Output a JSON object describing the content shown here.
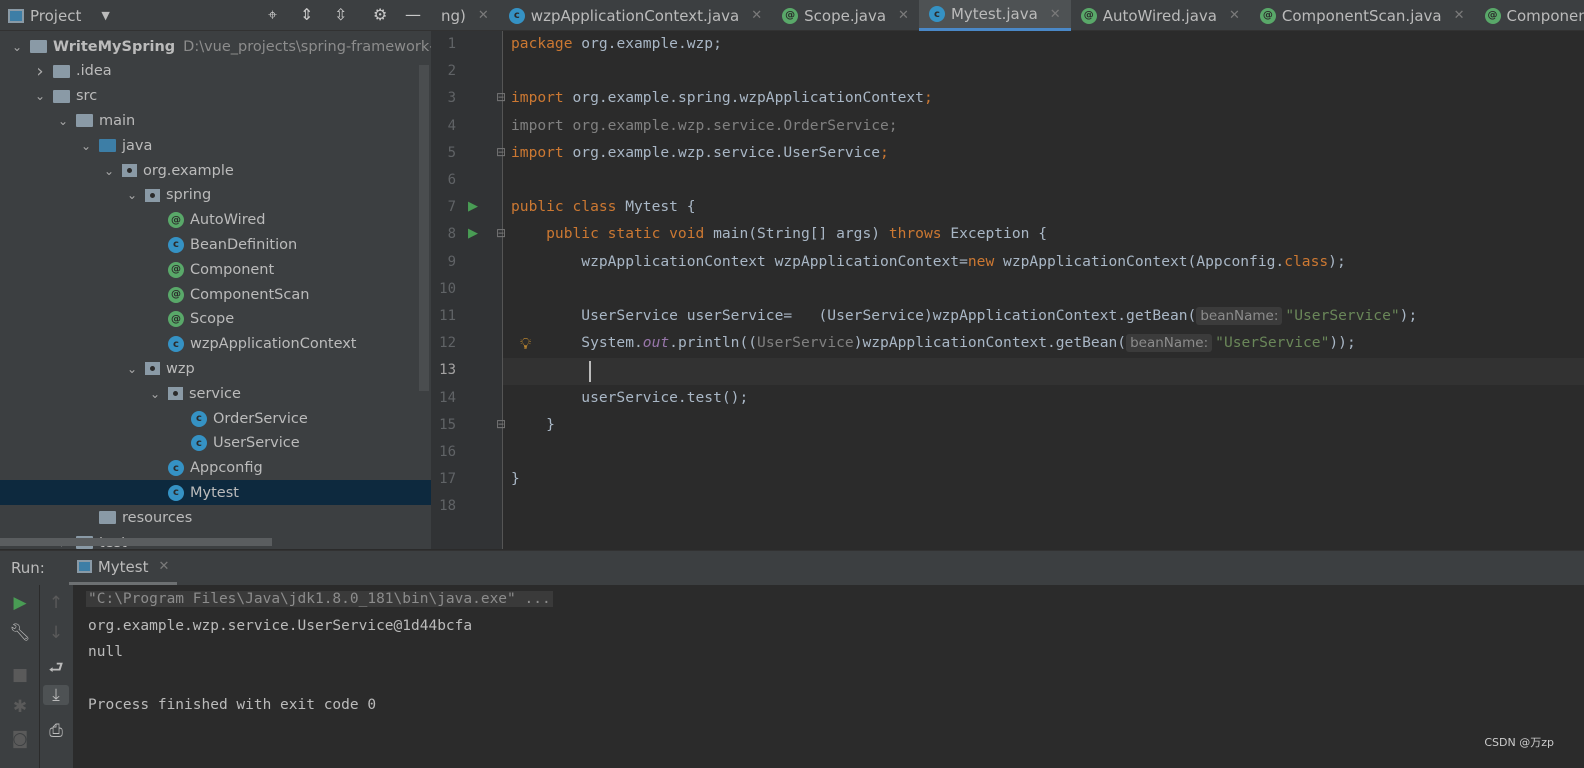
{
  "project_panel": {
    "title": "Project",
    "toolbar_icons": [
      "locate-icon",
      "expand-all-icon",
      "collapse-all-icon",
      "gear-icon",
      "minimize-icon"
    ]
  },
  "tabs": [
    {
      "label": "ng)",
      "icon": "none",
      "active": false
    },
    {
      "label": "wzpApplicationContext.java",
      "icon": "class",
      "active": false
    },
    {
      "label": "Scope.java",
      "icon": "annotation",
      "active": false
    },
    {
      "label": "Mytest.java",
      "icon": "class-run",
      "active": true
    },
    {
      "label": "AutoWired.java",
      "icon": "annotation",
      "active": false
    },
    {
      "label": "ComponentScan.java",
      "icon": "annotation",
      "active": false
    },
    {
      "label": "Component.jav",
      "icon": "annotation",
      "active": false
    }
  ],
  "tree": [
    {
      "label": "WriteMySpring",
      "path": "D:\\vue_projects\\spring-framework-",
      "level": 0,
      "arrow": "down",
      "icon": "module",
      "bold": true
    },
    {
      "label": ".idea",
      "level": 1,
      "arrow": "right",
      "icon": "folder"
    },
    {
      "label": "src",
      "level": 1,
      "arrow": "down",
      "icon": "folder"
    },
    {
      "label": "main",
      "level": 2,
      "arrow": "down",
      "icon": "folder"
    },
    {
      "label": "java",
      "level": 3,
      "arrow": "down",
      "icon": "src-folder"
    },
    {
      "label": "org.example",
      "level": 4,
      "arrow": "down",
      "icon": "package"
    },
    {
      "label": "spring",
      "level": 5,
      "arrow": "down",
      "icon": "package"
    },
    {
      "label": "AutoWired",
      "level": 6,
      "icon": "annotation"
    },
    {
      "label": "BeanDefinition",
      "level": 6,
      "icon": "class"
    },
    {
      "label": "Component",
      "level": 6,
      "icon": "annotation"
    },
    {
      "label": "ComponentScan",
      "level": 6,
      "icon": "annotation"
    },
    {
      "label": "Scope",
      "level": 6,
      "icon": "annotation"
    },
    {
      "label": "wzpApplicationContext",
      "level": 6,
      "icon": "class"
    },
    {
      "label": "wzp",
      "level": 5,
      "arrow": "down",
      "icon": "package"
    },
    {
      "label": "service",
      "level": 6,
      "arrow": "down",
      "icon": "package"
    },
    {
      "label": "OrderService",
      "level": 7,
      "icon": "class"
    },
    {
      "label": "UserService",
      "level": 7,
      "icon": "class"
    },
    {
      "label": "Appconfig",
      "level": 6,
      "icon": "class"
    },
    {
      "label": "Mytest",
      "level": 6,
      "icon": "class",
      "selected": true
    },
    {
      "label": "resources",
      "level": 3,
      "icon": "folder"
    },
    {
      "label": "test",
      "level": 2,
      "arrow": "right",
      "icon": "folder"
    }
  ],
  "editor": {
    "current_line": 13,
    "lines": [
      [
        [
          "kw",
          "package "
        ],
        [
          "",
          "org.example.wzp;"
        ]
      ],
      [],
      [
        [
          "kw",
          "import "
        ],
        [
          "",
          "org.example.spring.wzpApplicationContext"
        ],
        [
          "kw",
          ";"
        ]
      ],
      [
        [
          "gr",
          "import org.example.wzp.service.OrderService;"
        ]
      ],
      [
        [
          "kw",
          "import "
        ],
        [
          "",
          "org.example.wzp.service.UserService"
        ],
        [
          "kw",
          ";"
        ]
      ],
      [],
      [
        [
          "kw",
          "public class "
        ],
        [
          "",
          "Mytest {"
        ]
      ],
      [
        [
          "kw",
          "    public static void "
        ],
        [
          "",
          "main(String[] args) "
        ],
        [
          "kw",
          "throws "
        ],
        [
          "",
          "Exception {"
        ]
      ],
      [
        [
          "",
          "        wzpApplicationContext wzpApplicationContext="
        ],
        [
          "kw",
          "new "
        ],
        [
          "",
          "wzpApplicationContext(Appconfig."
        ],
        [
          "kw",
          "class"
        ],
        [
          "",
          "); "
        ]
      ],
      [],
      [
        [
          "",
          "        UserService userService=   (UserService)wzpApplicationContext.getBean("
        ],
        [
          "hint",
          "beanName:"
        ],
        [
          "str",
          "\"UserService\""
        ],
        [
          "",
          ");"
        ]
      ],
      [
        [
          "",
          "        System."
        ],
        [
          "st",
          "out"
        ],
        [
          "",
          ".println(("
        ],
        [
          "gr",
          "UserService"
        ],
        [
          "",
          ")wzpApplicationContext.getBean("
        ],
        [
          "hint",
          "beanName:"
        ],
        [
          "str",
          "\"UserService\""
        ],
        [
          "",
          "));"
        ]
      ],
      [
        [
          "",
          "        "
        ]
      ],
      [
        [
          "",
          "        userService.test();"
        ]
      ],
      [
        [
          "",
          "    }"
        ]
      ],
      [],
      [
        [
          "",
          "}"
        ]
      ],
      []
    ],
    "run_gutter_lines": [
      7,
      8
    ],
    "fold_lines": [
      3,
      5,
      8,
      15
    ],
    "bulb_line": 12
  },
  "run": {
    "label": "Run:",
    "tab": "Mytest",
    "output": [
      "\"C:\\Program Files\\Java\\jdk1.8.0_181\\bin\\java.exe\" ...",
      "org.example.wzp.service.UserService@1d44bcfa",
      "null",
      "",
      "Process finished with exit code 0"
    ]
  },
  "watermark": "CSDN @万zp",
  "colors": {
    "keyword": "#cc7832",
    "string": "#6a8759",
    "static": "#9876aa",
    "text": "#a9b7c6",
    "selection": "#0d293e",
    "accent": "#4a88c7"
  }
}
